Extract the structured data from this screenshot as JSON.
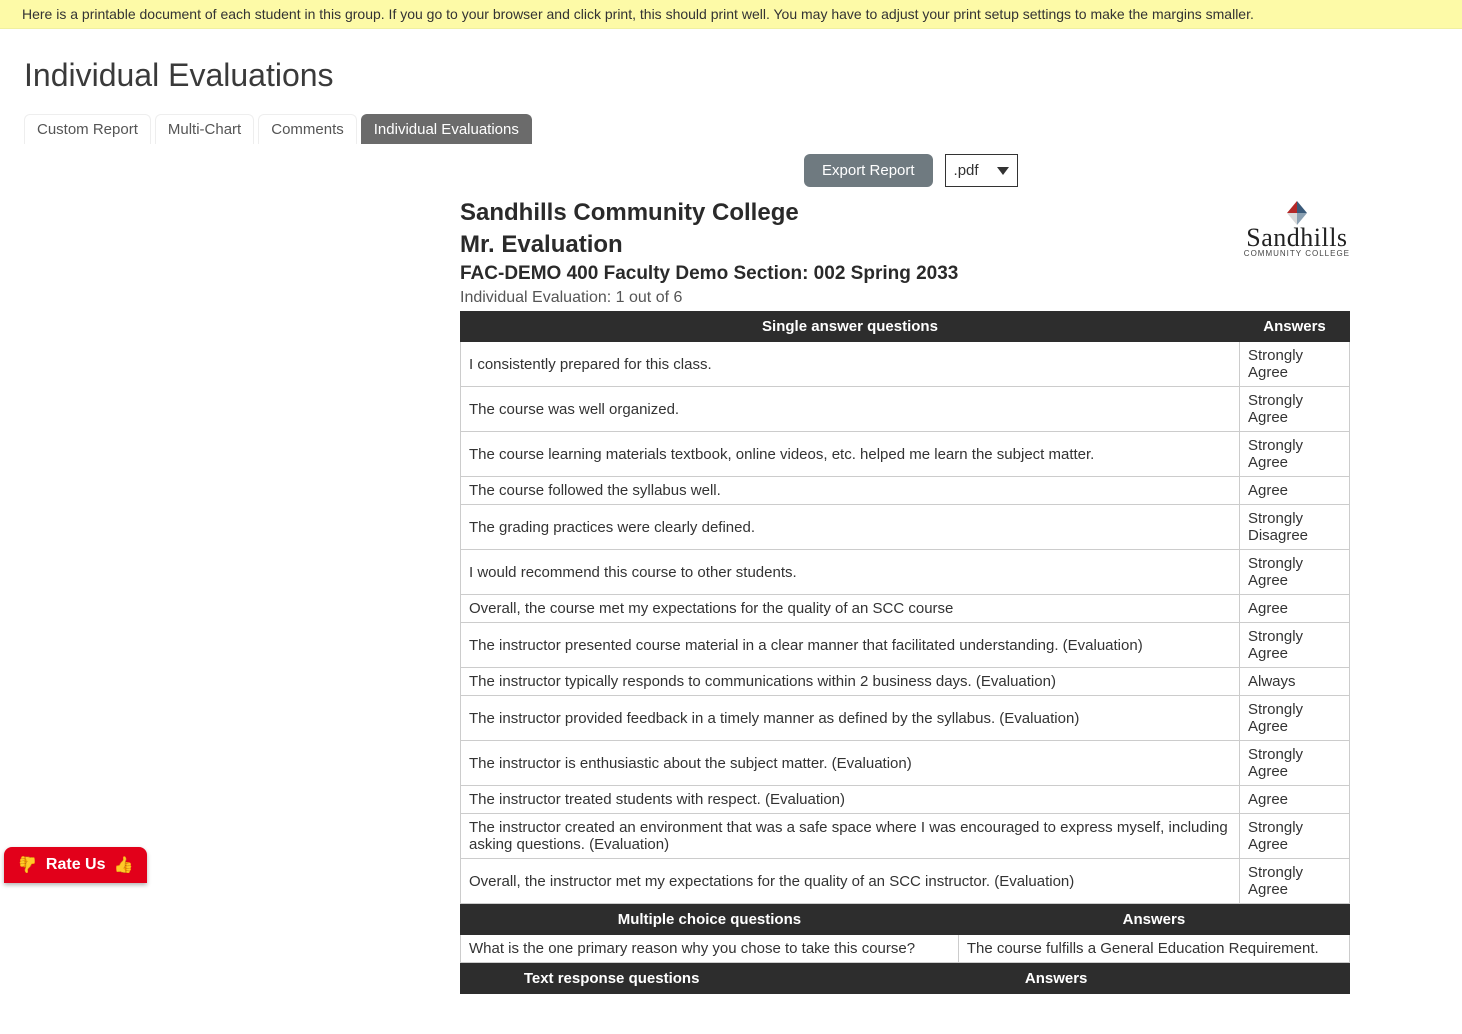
{
  "banner": "Here is a printable document of each student in this group. If you go to your browser and click print, this should print well. You may have to adjust your print setup settings to make the margins smaller.",
  "page_title": "Individual Evaluations",
  "tabs": [
    {
      "label": "Custom Report",
      "active": false
    },
    {
      "label": "Multi-Chart",
      "active": false
    },
    {
      "label": "Comments",
      "active": false
    },
    {
      "label": "Individual Evaluations",
      "active": true
    }
  ],
  "export": {
    "button": "Export Report",
    "format": ".pdf"
  },
  "report": {
    "institution": "Sandhills Community College",
    "instructor": "Mr. Evaluation",
    "course": "FAC-DEMO 400 Faculty Demo Section: 002 Spring 2033",
    "eval_index": "Individual Evaluation: 1 out of 6",
    "logo": {
      "text": "Sandhills",
      "sub": "COMMUNITY COLLEGE"
    }
  },
  "single_answer": {
    "header_q": "Single answer questions",
    "header_a": "Answers",
    "rows": [
      {
        "q": "I consistently prepared for this class.",
        "a": "Strongly Agree"
      },
      {
        "q": "The course was well organized.",
        "a": "Strongly Agree"
      },
      {
        "q": "The course learning materials textbook, online videos, etc. helped me learn the subject matter.",
        "a": "Strongly Agree"
      },
      {
        "q": "The course followed the syllabus well.",
        "a": "Agree"
      },
      {
        "q": "The grading practices were clearly defined.",
        "a": "Strongly Disagree"
      },
      {
        "q": "I would recommend this course to other students.",
        "a": "Strongly Agree"
      },
      {
        "q": "Overall, the course met my expectations for the quality of an SCC course",
        "a": "Agree"
      },
      {
        "q": "The instructor presented course material in a clear manner that facilitated understanding. (Evaluation)",
        "a": "Strongly Agree"
      },
      {
        "q": "The instructor typically responds to communications within 2 business days. (Evaluation)",
        "a": "Always"
      },
      {
        "q": "The instructor provided feedback in a timely manner as defined by the syllabus. (Evaluation)",
        "a": "Strongly Agree"
      },
      {
        "q": "The instructor is enthusiastic about the subject matter. (Evaluation)",
        "a": "Strongly Agree"
      },
      {
        "q": "The instructor treated students with respect. (Evaluation)",
        "a": "Agree"
      },
      {
        "q": "The instructor created an environment that was a safe space where I was encouraged to express myself, including asking questions. (Evaluation)",
        "a": "Strongly Agree"
      },
      {
        "q": "Overall, the instructor met my expectations for the quality of an SCC instructor. (Evaluation)",
        "a": "Strongly Agree"
      }
    ]
  },
  "multiple_choice": {
    "header_q": "Multiple choice questions",
    "header_a": "Answers",
    "rows": [
      {
        "q": "What is the one primary reason why you chose to take this course?",
        "a": "The course fulfills a General Education Requirement."
      }
    ]
  },
  "text_response": {
    "header_q": "Text response questions",
    "header_a": "Answers"
  },
  "rate_us": {
    "label": "Rate Us"
  }
}
